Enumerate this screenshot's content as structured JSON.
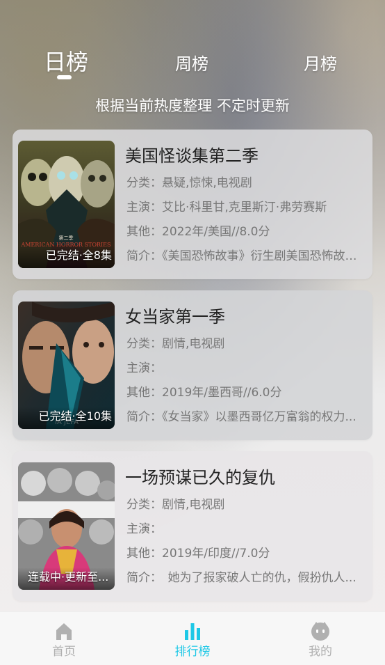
{
  "tabs": {
    "day": "日榜",
    "week": "周榜",
    "month": "月榜",
    "active": "day"
  },
  "subtitle": "根据当前热度整理 不定时更新",
  "items": [
    {
      "title": "美国怪谈集第二季",
      "status": "已完结·全8集",
      "category_label": "分类：",
      "category": "悬疑,惊悚,电视剧",
      "cast_label": "主演：",
      "cast": "艾比·科里甘,克里斯汀·弗劳赛斯",
      "other_label": "其他：",
      "other": "2022年/美国//8.0分",
      "intro_label": "简介：",
      "intro": "《美国恐怖故事》衍生剧美国恐怖故事..."
    },
    {
      "title": "女当家第一季",
      "status": "已完结·全10集",
      "category_label": "分类：",
      "category": "剧情,电视剧",
      "cast_label": "主演：",
      "cast": "",
      "other_label": "其他：",
      "other": "2019年/墨西哥//6.0分",
      "intro_label": "简介：",
      "intro": "《女当家》以墨西哥亿万富翁的权力..."
    },
    {
      "title": "一场预谋已久的复仇",
      "status": "连载中·更新至...",
      "category_label": "分类：",
      "category": "剧情,电视剧",
      "cast_label": "主演：",
      "cast": "",
      "other_label": "其他：",
      "other": "2019年/印度//7.0分",
      "intro_label": "简介：",
      "intro": "　她为了报家破人亡的仇，假扮仇人..."
    }
  ],
  "nav": {
    "home": "首页",
    "rank": "排行榜",
    "mine": "我的",
    "active": "rank"
  },
  "colors": {
    "accent": "#1ec8e6",
    "inactive": "#b0b0b0"
  }
}
